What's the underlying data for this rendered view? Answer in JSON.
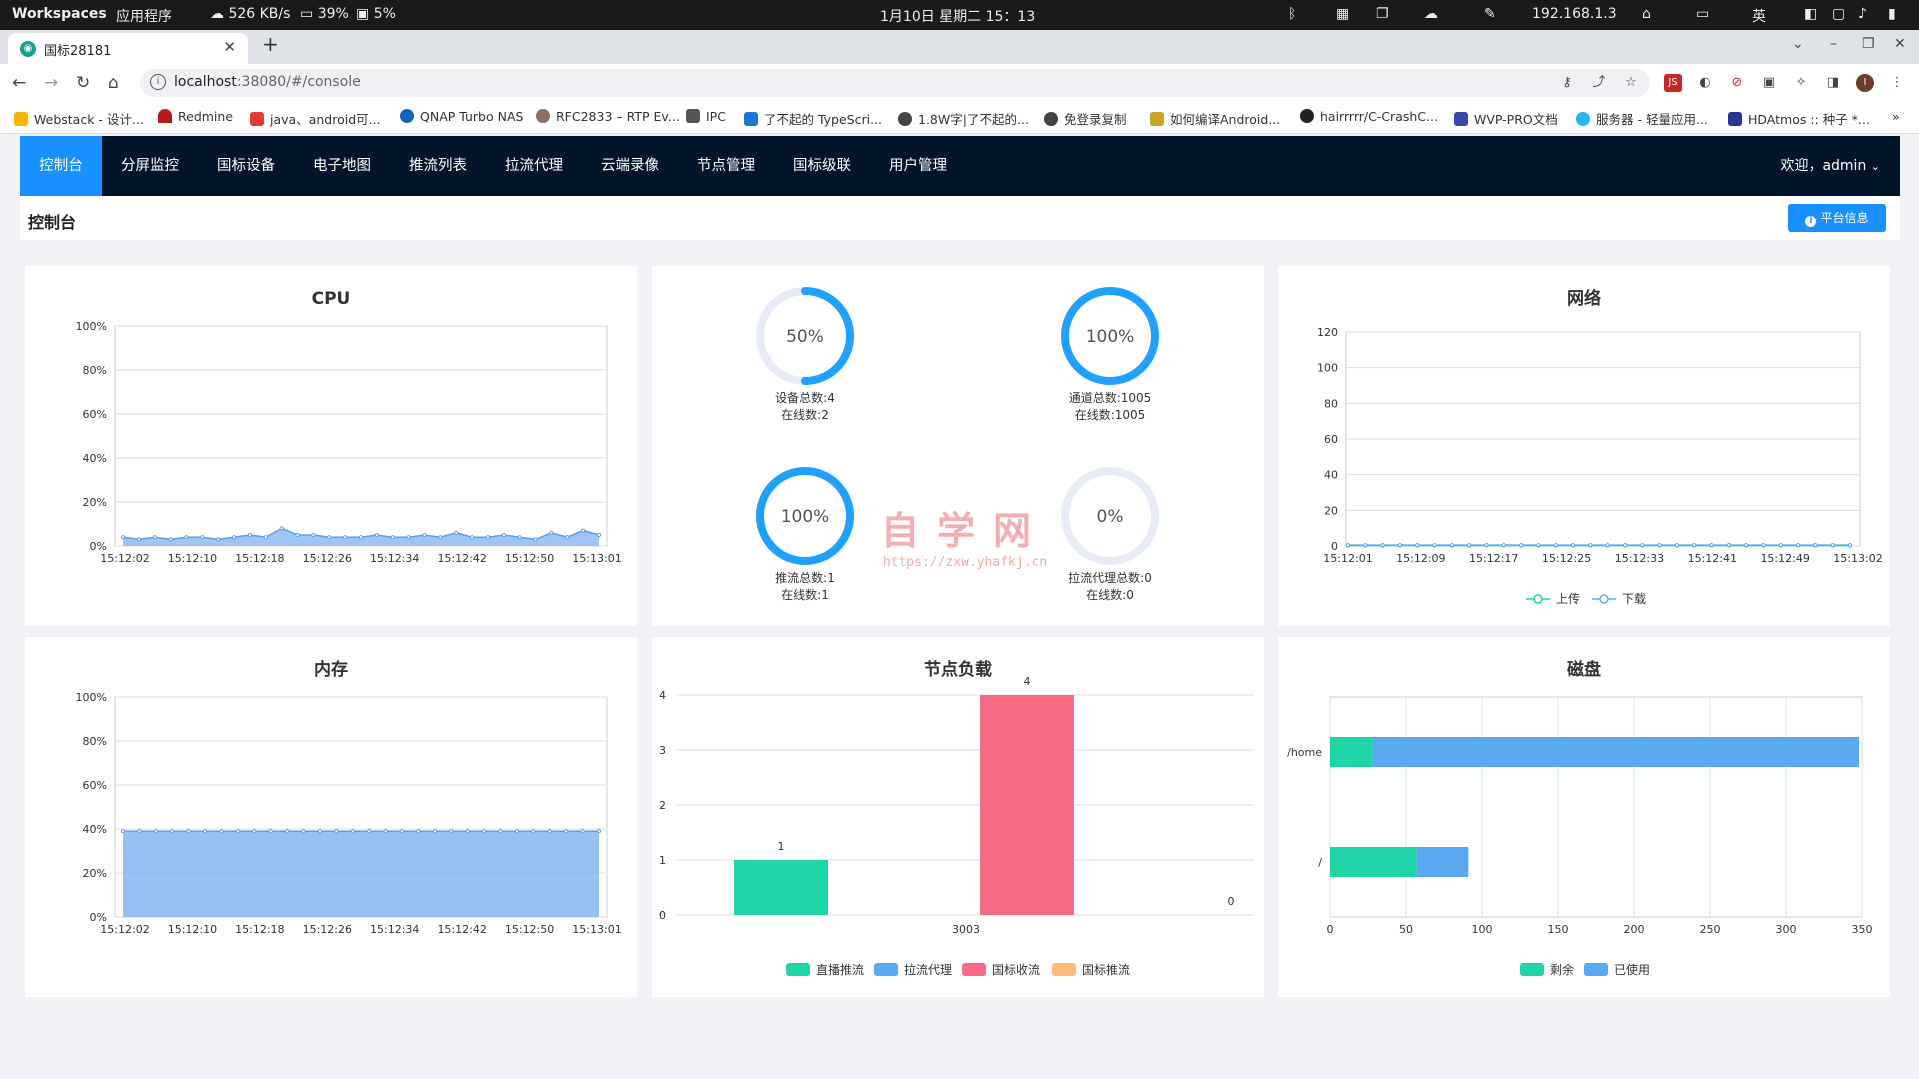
{
  "system_bar": {
    "workspaces": "Workspaces",
    "apps": "应用程序",
    "net": "526 KB/s",
    "cpu": "39%",
    "mem": "5%",
    "datetime": "1月10日 星期二 15：13",
    "ip": "192.168.1.3",
    "ime": "英"
  },
  "browser": {
    "tab_title": "国标28181",
    "url_host": "localhost",
    "url_rest": ":38080/#/console",
    "bookmarks": [
      "Webstack - 设计...",
      "Redmine",
      "java、android可...",
      "QNAP Turbo NAS",
      "RFC2833 – RTP Ev...",
      "IPC",
      "了不起的 TypeScri...",
      "1.8W字|了不起的...",
      "免登录复制",
      "如何编译Android...",
      "hairrrrr/C-CrashC...",
      "WVP-PRO文档",
      "服务器 - 轻量应用...",
      "HDAtmos :: 种子 *..."
    ],
    "bookmarks_more": "»"
  },
  "app": {
    "menu": [
      "控制台",
      "分屏监控",
      "国标设备",
      "电子地图",
      "推流列表",
      "拉流代理",
      "云端录像",
      "节点管理",
      "国标级联",
      "用户管理"
    ],
    "active_menu": 0,
    "welcome": "欢迎，admin",
    "page_title": "控制台",
    "platform_button": "平台信息"
  },
  "watermark": {
    "text": "自学网",
    "url": "https://zxw.yhafkj.cn"
  },
  "cards": {
    "cpu": {
      "title": "CPU",
      "y_ticks": [
        "0%",
        "20%",
        "40%",
        "60%",
        "80%",
        "100%"
      ],
      "x_ticks": [
        "15:12:02",
        "15:12:10",
        "15:12:18",
        "15:12:26",
        "15:12:34",
        "15:12:42",
        "15:12:50",
        "15:13:01"
      ]
    },
    "gauges": [
      {
        "percent": "50%",
        "value": 0.5,
        "line1": "设备总数:4",
        "line2": "在线数:2"
      },
      {
        "percent": "100%",
        "value": 1.0,
        "line1": "通道总数:1005",
        "line2": "在线数:1005"
      },
      {
        "percent": "100%",
        "value": 1.0,
        "line1": "推流总数:1",
        "line2": "在线数:1"
      },
      {
        "percent": "0%",
        "value": 0.0,
        "line1": "拉流代理总数:0",
        "line2": "在线数:0"
      }
    ],
    "network": {
      "title": "网络",
      "y_ticks": [
        "0",
        "20",
        "40",
        "60",
        "80",
        "100",
        "120"
      ],
      "x_ticks": [
        "15:12:01",
        "15:12:09",
        "15:12:17",
        "15:12:25",
        "15:12:33",
        "15:12:41",
        "15:12:49",
        "15:13:02"
      ],
      "legend": [
        "上传",
        "下载"
      ]
    },
    "memory": {
      "title": "内存",
      "y_ticks": [
        "0%",
        "20%",
        "40%",
        "60%",
        "80%",
        "100%"
      ],
      "x_ticks": [
        "15:12:02",
        "15:12:10",
        "15:12:18",
        "15:12:26",
        "15:12:34",
        "15:12:42",
        "15:12:50",
        "15:13:01"
      ]
    },
    "node_load": {
      "title": "节点负载",
      "legend": [
        "直播推流",
        "拉流代理",
        "国标收流",
        "国标推流"
      ],
      "category": "3003",
      "y_ticks": [
        "0",
        "1",
        "2",
        "3",
        "4"
      ],
      "bar_labels": [
        "1",
        "0",
        "4",
        "0"
      ]
    },
    "disk": {
      "title": "磁盘",
      "x_ticks": [
        "0",
        "50",
        "100",
        "150",
        "200",
        "250",
        "300",
        "350"
      ],
      "categories": [
        "/home",
        "/"
      ],
      "legend": [
        "剩余",
        "已使用"
      ]
    }
  },
  "chart_data": [
    {
      "type": "area",
      "title": "CPU",
      "x": [
        "15:12:02",
        "15:12:04",
        "15:12:06",
        "15:12:08",
        "15:12:10",
        "15:12:12",
        "15:12:14",
        "15:12:16",
        "15:12:18",
        "15:12:20",
        "15:12:22",
        "15:12:24",
        "15:12:26",
        "15:12:28",
        "15:12:30",
        "15:12:32",
        "15:12:34",
        "15:12:36",
        "15:12:38",
        "15:12:40",
        "15:12:42",
        "15:12:44",
        "15:12:46",
        "15:12:48",
        "15:12:50",
        "15:12:52",
        "15:12:54",
        "15:12:56",
        "15:12:58",
        "15:13:01"
      ],
      "values": [
        0.04,
        0.03,
        0.04,
        0.03,
        0.04,
        0.04,
        0.03,
        0.04,
        0.05,
        0.04,
        0.08,
        0.05,
        0.05,
        0.04,
        0.04,
        0.04,
        0.05,
        0.04,
        0.04,
        0.05,
        0.04,
        0.06,
        0.04,
        0.04,
        0.05,
        0.04,
        0.03,
        0.06,
        0.04,
        0.07,
        0.05
      ],
      "ylim": [
        0,
        1
      ]
    },
    {
      "type": "line",
      "title": "网络",
      "x": [
        "15:12:01",
        "15:12:03",
        "15:12:05",
        "15:12:07",
        "15:12:09",
        "15:12:11",
        "15:12:13",
        "15:12:15",
        "15:12:17",
        "15:12:19",
        "15:12:21",
        "15:12:23",
        "15:12:25",
        "15:12:27",
        "15:12:29",
        "15:12:31",
        "15:12:33",
        "15:12:35",
        "15:12:37",
        "15:12:39",
        "15:12:41",
        "15:12:43",
        "15:12:45",
        "15:12:47",
        "15:12:49",
        "15:12:51",
        "15:12:53",
        "15:12:55",
        "15:12:57",
        "15:13:02"
      ],
      "series": [
        {
          "name": "上传",
          "values": [
            0.3,
            0.3,
            0.3,
            0.3,
            0.3,
            0.3,
            0.3,
            0.3,
            0.3,
            0.3,
            0.3,
            0.3,
            0.3,
            0.3,
            0.3,
            0.3,
            0.3,
            0.3,
            0.3,
            0.3,
            0.3,
            0.3,
            0.3,
            0.3,
            0.3,
            0.3,
            0.3,
            0.3,
            0.3,
            0.3
          ]
        },
        {
          "name": "下载",
          "values": [
            0.5,
            0.5,
            0.5,
            0.5,
            0.5,
            0.5,
            0.5,
            0.5,
            0.5,
            0.5,
            0.5,
            0.5,
            0.5,
            0.5,
            0.5,
            0.5,
            0.5,
            0.5,
            0.5,
            0.5,
            0.5,
            0.5,
            0.5,
            0.5,
            0.5,
            0.5,
            0.5,
            0.5,
            0.5,
            0.5
          ]
        }
      ],
      "ylim": [
        0,
        120
      ]
    },
    {
      "type": "area",
      "title": "内存",
      "x": [
        "15:12:02",
        "15:12:04",
        "15:12:06",
        "15:12:08",
        "15:12:10",
        "15:12:12",
        "15:12:14",
        "15:12:16",
        "15:12:18",
        "15:12:20",
        "15:12:22",
        "15:12:24",
        "15:12:26",
        "15:12:28",
        "15:12:30",
        "15:12:32",
        "15:12:34",
        "15:12:36",
        "15:12:38",
        "15:12:40",
        "15:12:42",
        "15:12:44",
        "15:12:46",
        "15:12:48",
        "15:12:50",
        "15:12:52",
        "15:12:54",
        "15:12:56",
        "15:12:58",
        "15:13:01"
      ],
      "values": [
        0.39,
        0.39,
        0.39,
        0.39,
        0.39,
        0.39,
        0.39,
        0.39,
        0.39,
        0.39,
        0.39,
        0.39,
        0.39,
        0.39,
        0.39,
        0.39,
        0.39,
        0.39,
        0.39,
        0.39,
        0.39,
        0.39,
        0.39,
        0.39,
        0.39,
        0.39,
        0.39,
        0.39,
        0.39,
        0.39
      ],
      "ylim": [
        0,
        1
      ]
    },
    {
      "type": "bar",
      "title": "节点负载",
      "categories": [
        "3003"
      ],
      "series": [
        {
          "name": "直播推流",
          "values": [
            1
          ],
          "color": "#1fd4a7"
        },
        {
          "name": "拉流代理",
          "values": [
            0
          ],
          "color": "#5aa9f0"
        },
        {
          "name": "国标收流",
          "values": [
            4
          ],
          "color": "#f76b86"
        },
        {
          "name": "国标推流",
          "values": [
            0
          ],
          "color": "#fbb97a"
        }
      ],
      "ylim": [
        0,
        4
      ]
    },
    {
      "type": "bar",
      "orientation": "horizontal",
      "stacked": true,
      "title": "磁盘",
      "categories": [
        "/home",
        "/"
      ],
      "series": [
        {
          "name": "剩余",
          "values": [
            28,
            57
          ],
          "color": "#1fd4a7"
        },
        {
          "name": "已使用",
          "values": [
            320,
            34
          ],
          "color": "#5aa9f0"
        }
      ],
      "xlim": [
        0,
        350
      ]
    }
  ]
}
